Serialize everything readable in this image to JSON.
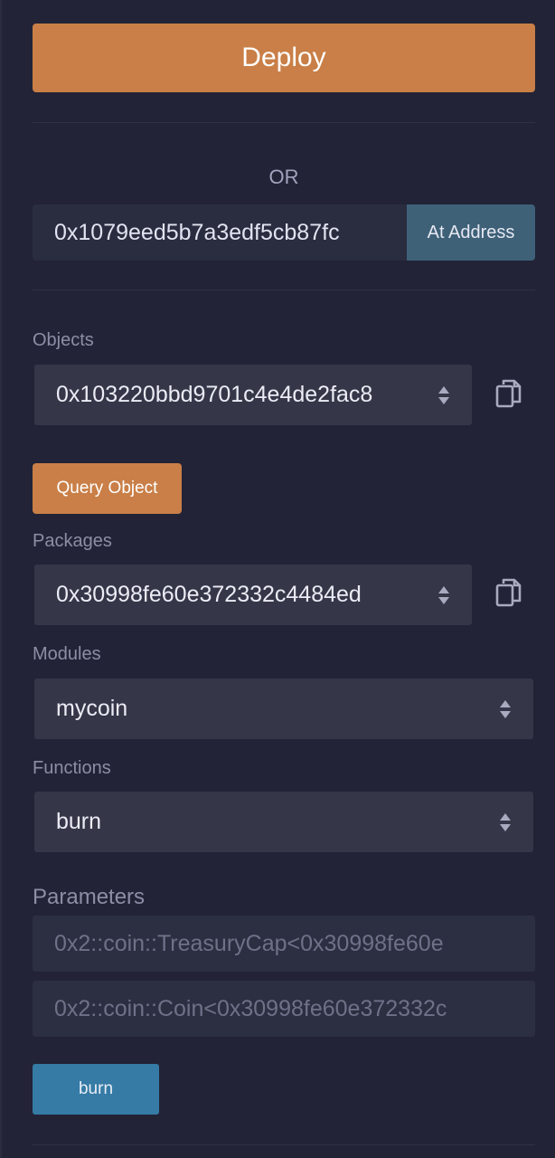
{
  "deploy": {
    "label": "Deploy"
  },
  "or_separator": "OR",
  "at_address": {
    "value": "0x1079eed5b7a3edf5cb87fc",
    "button_label": "At Address"
  },
  "objects": {
    "label": "Objects",
    "selected": "0x103220bbd9701c4e4de2fac8",
    "copy_icon": "copy-icon"
  },
  "query_object": {
    "label": "Query Object"
  },
  "packages": {
    "label": "Packages",
    "selected": "0x30998fe60e372332c4484ed",
    "copy_icon": "copy-icon"
  },
  "modules": {
    "label": "Modules",
    "selected": "mycoin"
  },
  "functions": {
    "label": "Functions",
    "selected": "burn"
  },
  "parameters": {
    "label": "Parameters",
    "inputs": [
      {
        "placeholder": "0x2::coin::TreasuryCap<0x30998fe60e"
      },
      {
        "placeholder": "0x2::coin::Coin<0x30998fe60e372332c"
      }
    ]
  },
  "execute": {
    "label": "burn"
  },
  "colors": {
    "background": "#222336",
    "accent_orange": "#c97f47",
    "address_button": "#3e6178",
    "execute_button": "#357ba6"
  }
}
